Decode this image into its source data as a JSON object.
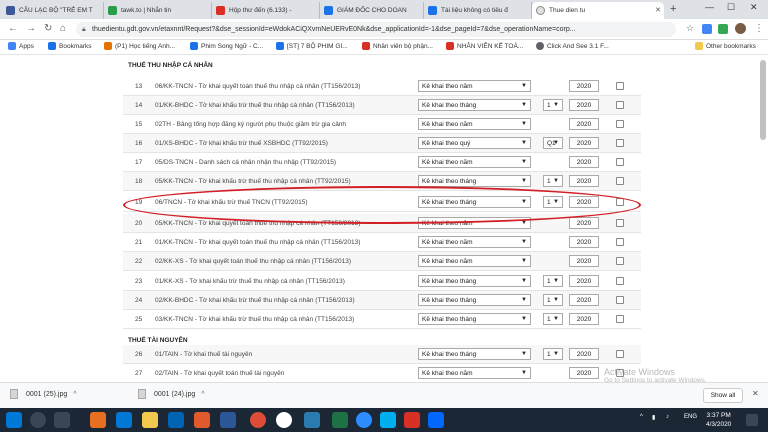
{
  "tabs": [
    {
      "label": "CÂU LẠC BỘ \"TRẺ EM T",
      "color": "#3b5998"
    },
    {
      "label": "tawk.to | Nhắn tin",
      "color": "#2a9d4a"
    },
    {
      "label": "Hộp thư đến (6.133) -",
      "color": "#d93025"
    },
    {
      "label": "GIÁM ĐỐC CHO DOAN",
      "color": "#1a73e8"
    },
    {
      "label": "Tài liệu không có tiêu đ",
      "color": "#1a73e8"
    },
    {
      "label": "Thue dien tu",
      "color": "#555555"
    }
  ],
  "url": "thuedientu.gdt.gov.vn/etaxnnt/Request?&dse_sessionId=eWdokACiQXvmNeUERvE0Nk&dse_applicationId=-1&dse_pageId=7&dse_operationName=corp...",
  "bookmarks": [
    "Apps",
    "Bookmarks",
    "(P1) Học tiếng Anh...",
    "Phim Song Ngữ - C...",
    "[ST] 7 BỘ PHIM GI...",
    "Nhân viên bộ phận...",
    "NHÂN VIÊN KẾ TOÁ...",
    "Click And See 3.1 F...",
    "Other bookmarks"
  ],
  "sections": {
    "income": "THUẾ THU NHẬP CÁ NHÂN",
    "resource": "THUẾ TÀI NGUYÊN"
  },
  "rows": [
    {
      "num": "13",
      "name": "06/KK-TNCN - Tờ khai quyết toán thuế thu nhập cá nhân (TT156/2013)",
      "period": "Kê khai theo năm",
      "sub": "",
      "year": "2020"
    },
    {
      "num": "14",
      "name": "01/KK-BHDC - Tờ khai khấu trừ thuế thu nhập cá nhân (TT156/2013)",
      "period": "Kê khai theo tháng",
      "sub": "1",
      "year": "2020"
    },
    {
      "num": "15",
      "name": "02TH - Bảng tổng hợp đăng ký người phụ thuộc giảm trừ gia cảnh",
      "period": "Kê khai theo năm",
      "sub": "",
      "year": "2020"
    },
    {
      "num": "16",
      "name": "01/XS-BHDC - Tờ khai khấu trừ thuế XSBHDC (TT92/2015)",
      "period": "Kê khai theo quý",
      "sub": "Q1",
      "year": "2020"
    },
    {
      "num": "17",
      "name": "05/DS-TNCN - Danh sách cá nhân nhận thu nhập (TT92/2015)",
      "period": "Kê khai theo năm",
      "sub": "",
      "year": "2020"
    },
    {
      "num": "18",
      "name": "05/KK-TNCN - Tờ khai khấu trừ thuế thu nhập cá nhân (TT92/2015)",
      "period": "Kê khai theo tháng",
      "sub": "1",
      "year": "2020"
    },
    {
      "num": "19",
      "name": "06/TNCN - Tờ khai khấu trừ thuế TNCN (TT92/2015)",
      "period": "Kê khai theo tháng",
      "sub": "1",
      "year": "2020"
    },
    {
      "num": "20",
      "name": "05/KK-TNCN - Tờ khai quyết toán thuế thu nhập cá nhân (TT156/2013)",
      "period": "Kê khai theo năm",
      "sub": "",
      "year": "2020"
    },
    {
      "num": "21",
      "name": "01/KK-TNCN - Tờ khai quyết toán thuế thu nhập cá nhân (TT156/2013)",
      "period": "Kê khai theo năm",
      "sub": "",
      "year": "2020"
    },
    {
      "num": "22",
      "name": "02/KK-XS - Tờ khai quyết toán thuế thu nhập cá nhân (TT156/2013)",
      "period": "Kê khai theo năm",
      "sub": "",
      "year": "2020"
    },
    {
      "num": "23",
      "name": "01/KK-XS - Tờ khai khấu trừ thuế thu nhập cá nhân (TT156/2013)",
      "period": "Kê khai theo tháng",
      "sub": "1",
      "year": "2020"
    },
    {
      "num": "24",
      "name": "02/KK-BHDC - Tờ khai khấu trừ thuế thu nhập cá nhân (TT156/2013)",
      "period": "Kê khai theo tháng",
      "sub": "1",
      "year": "2020"
    },
    {
      "num": "25",
      "name": "03/KK-TNCN - Tờ khai khấu trừ thuế thu nhập cá nhân (TT156/2013)",
      "period": "Kê khai theo tháng",
      "sub": "1",
      "year": "2020"
    },
    {
      "num": "26",
      "name": "01/TAIN - Tờ khai thuế tài nguyên",
      "period": "Kê khai theo tháng",
      "sub": "1",
      "year": "2020"
    },
    {
      "num": "27",
      "name": "02/TAIN - Tờ khai quyết toán thuế tài nguyên",
      "period": "Kê khai theo năm",
      "sub": "",
      "year": "2020"
    }
  ],
  "watermark": {
    "title": "Activate Windows",
    "sub": "Go to Settings to activate Windows."
  },
  "downloads": [
    {
      "name": "0001 (25).jpg"
    },
    {
      "name": "0001 (24).jpg"
    }
  ],
  "show_all": "Show all",
  "clock": {
    "time": "3:37 PM",
    "date": "4/3/2020"
  },
  "lang": "ENG",
  "colors": {
    "highlight": "#d21f26",
    "taskbar": "#1c2735"
  }
}
